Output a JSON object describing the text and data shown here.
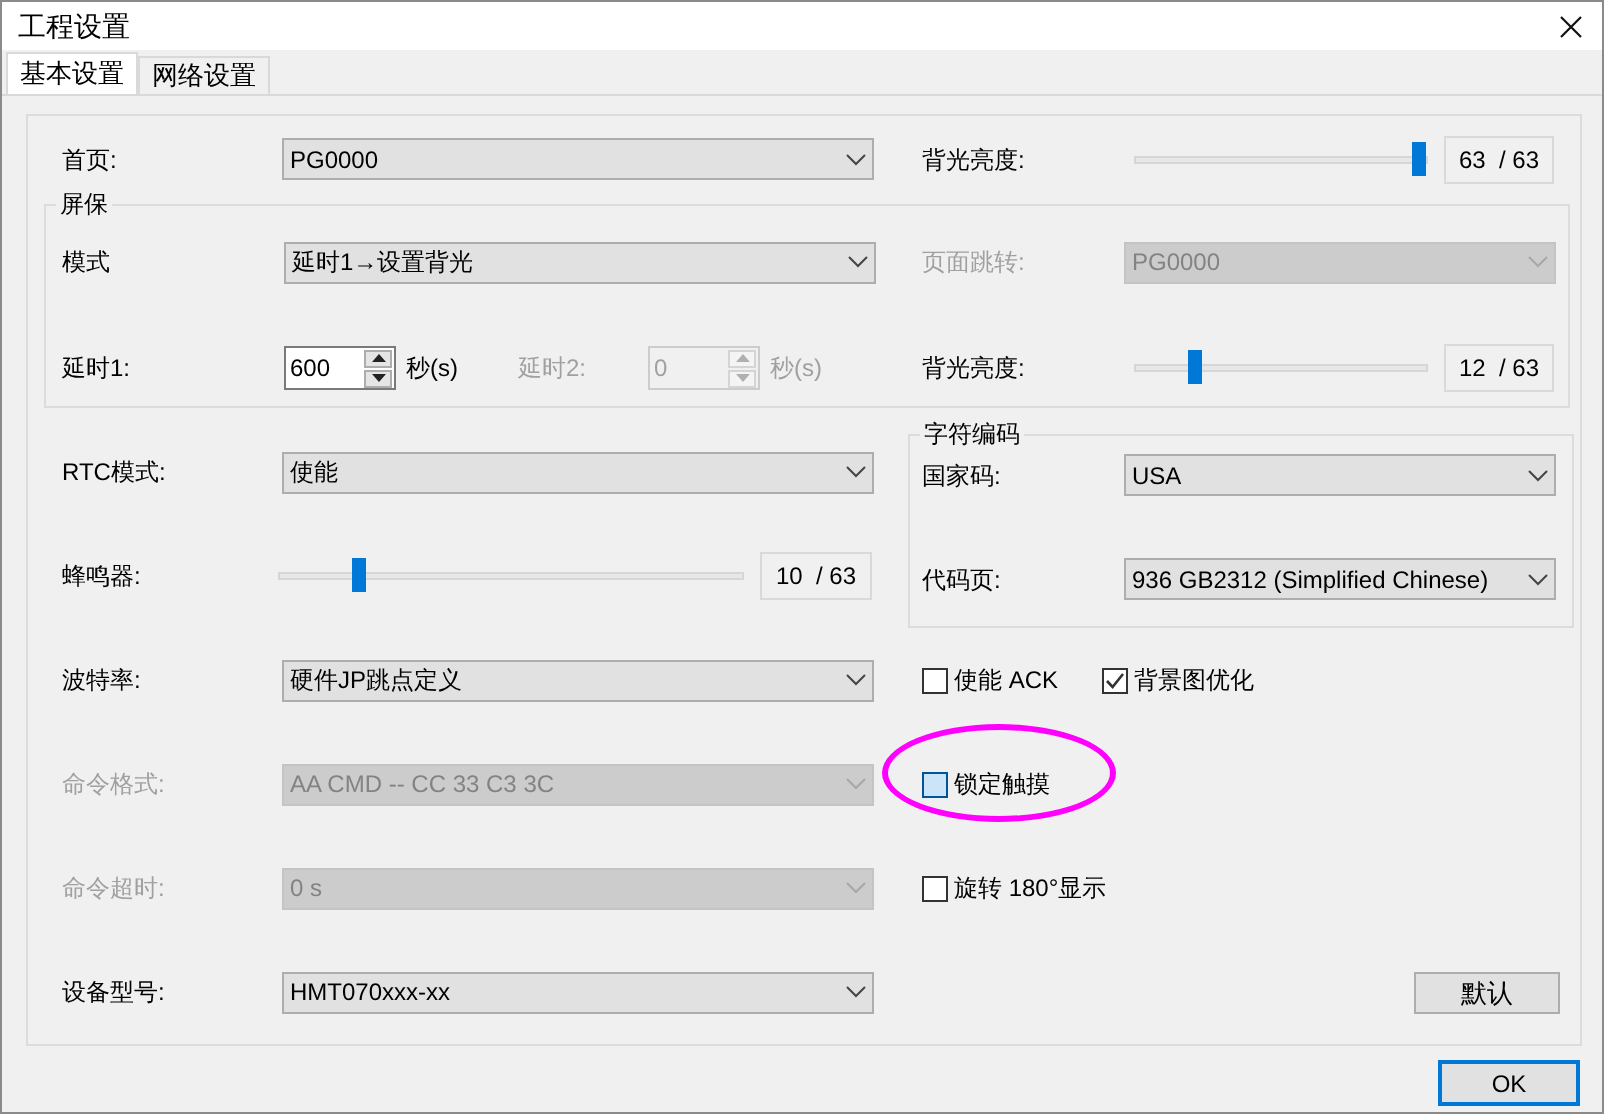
{
  "window": {
    "title": "工程设置"
  },
  "tabs": [
    {
      "label": "基本设置",
      "selected": true
    },
    {
      "label": "网络设置",
      "selected": false
    }
  ],
  "home_page": {
    "label": "首页:",
    "value": "PG0000",
    "disabled": false
  },
  "backlight": {
    "label": "背光亮度:",
    "level": 1,
    "reading": "63  / 63"
  },
  "screensaver": {
    "title": "屏保",
    "mode": {
      "label": "模式",
      "value": "延时1→设置背光",
      "disabled": false
    },
    "page_jump": {
      "label": "页面跳转:",
      "value": "PG0000",
      "disabled": true
    },
    "delay1": {
      "label": "延时1:",
      "value": "600",
      "unit": "秒(s)",
      "disabled": false
    },
    "delay2": {
      "label": "延时2:",
      "value": "0",
      "unit": "秒(s)",
      "disabled": true
    },
    "backlight": {
      "label": "背光亮度:",
      "level": 0.19,
      "reading": "12  / 63"
    }
  },
  "left_fields": [
    {
      "kind": "combo",
      "label": "RTC模式:",
      "value": "使能",
      "disabled": false
    },
    {
      "kind": "slider",
      "label": "蜂鸣器:",
      "level": 0.16,
      "reading": "10  / 63"
    },
    {
      "kind": "combo",
      "label": "波特率:",
      "value": "硬件JP跳点定义",
      "disabled": false
    },
    {
      "kind": "combo",
      "label": "命令格式:",
      "value": "AA CMD -- CC 33 C3 3C",
      "disabled": true
    },
    {
      "kind": "combo",
      "label": "命令超时:",
      "value": "0 s",
      "disabled": true
    },
    {
      "kind": "combo",
      "label": "设备型号:",
      "value": "HMT070xxx-xx",
      "disabled": false
    }
  ],
  "encoding": {
    "title": "字符编码",
    "fields": [
      {
        "label": "国家码:",
        "value": "USA",
        "disabled": false
      },
      {
        "label": "代码页:",
        "value": "936 GB2312 (Simplified Chinese)",
        "disabled": false
      }
    ]
  },
  "option_rows": [
    [
      {
        "label": "使能 ACK",
        "checked": false,
        "hovered": false,
        "circled": false
      },
      {
        "label": "背景图优化",
        "checked": true,
        "hovered": false,
        "circled": false
      }
    ],
    [
      {
        "label": "锁定触摸",
        "checked": false,
        "hovered": true,
        "circled": true
      }
    ],
    [
      {
        "label": "旋转 180°显示",
        "checked": false,
        "hovered": false,
        "circled": false
      }
    ]
  ],
  "default_button": "默认",
  "ok_button": "OK"
}
